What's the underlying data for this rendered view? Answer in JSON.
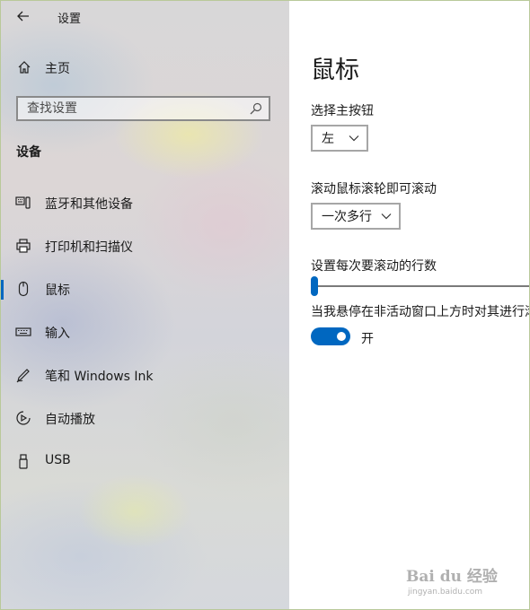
{
  "window": {
    "app_title": "设置"
  },
  "sidebar": {
    "home_label": "主页",
    "search_placeholder": "查找设置",
    "section_title": "设备",
    "items": [
      {
        "label": "蓝牙和其他设备",
        "icon": "bluetooth-devices-icon"
      },
      {
        "label": "打印机和扫描仪",
        "icon": "printer-icon"
      },
      {
        "label": "鼠标",
        "icon": "mouse-icon",
        "selected": true
      },
      {
        "label": "输入",
        "icon": "keyboard-icon"
      },
      {
        "label": "笔和 Windows Ink",
        "icon": "pen-icon"
      },
      {
        "label": "自动播放",
        "icon": "autoplay-icon"
      },
      {
        "label": "USB",
        "icon": "usb-icon"
      }
    ]
  },
  "main": {
    "title": "鼠标",
    "primary_button": {
      "label": "选择主按钮",
      "value": "左"
    },
    "scroll_mode": {
      "label": "滚动鼠标滚轮即可滚动",
      "value": "一次多行"
    },
    "scroll_lines": {
      "label": "设置每次要滚动的行数",
      "level": 0.0
    },
    "inactive_scroll": {
      "label": "当我悬停在非活动窗口上方时对其进行滚动",
      "state": "开",
      "on": true
    }
  },
  "watermark": {
    "main": "Bai du 经验",
    "sub": "jingyan.baidu.com"
  },
  "colors": {
    "accent": "#0067c0",
    "sidebar": "#d8d7d8"
  }
}
